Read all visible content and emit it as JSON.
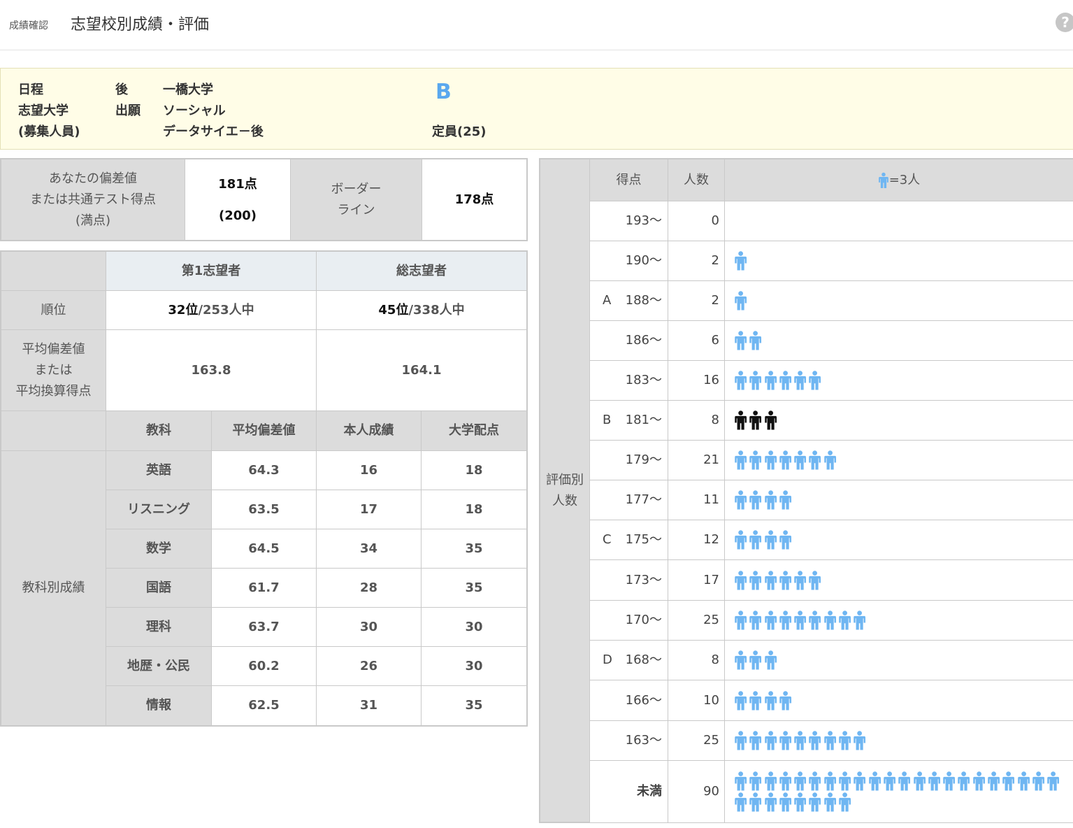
{
  "header": {
    "breadcrumb": "成績確認",
    "title": "志望校別成績・評価",
    "help_icon": "help-circle-icon"
  },
  "info": {
    "label_schedule": "日程",
    "label_university": "志望大学",
    "label_capacity": "(募集人員)",
    "schedule_value": "後",
    "application_label": "出願",
    "university_name": "一橋大学",
    "department": "ソーシャル",
    "course": "データサイエ－後",
    "rank": "B",
    "capacity": "定員(25)",
    "rank_color": "#5aa8ee",
    "background": "#fffde7"
  },
  "score": {
    "label_line1": "あなたの偏差値",
    "label_line2": "または共通テスト得点",
    "label_line3": "(満点)",
    "score_value": "181点",
    "full_marks": "(200)",
    "border_label_line1": "ボーダー",
    "border_label_line2": "ライン",
    "border_value": "178点"
  },
  "ranking": {
    "col1": "第1志望者",
    "col2": "総志望者",
    "rank_label": "順位",
    "first_rank": "32位",
    "first_total": "/253人中",
    "all_rank": "45位",
    "all_total": "/338人中",
    "avg_label_line1": "平均偏差値",
    "avg_label_line2": "または",
    "avg_label_line3": "平均換算得点",
    "first_avg": "163.8",
    "all_avg": "164.1"
  },
  "subjects": {
    "section_label": "教科別成績",
    "headers": [
      "教科",
      "平均偏差値",
      "本人成績",
      "大学配点"
    ],
    "rows": [
      {
        "subject": "英語",
        "avg": "64.3",
        "mine": "16",
        "points": "18"
      },
      {
        "subject": "リスニング",
        "avg": "63.5",
        "mine": "17",
        "points": "18"
      },
      {
        "subject": "数学",
        "avg": "64.5",
        "mine": "34",
        "points": "35"
      },
      {
        "subject": "国語",
        "avg": "61.7",
        "mine": "28",
        "points": "35"
      },
      {
        "subject": "理科",
        "avg": "63.7",
        "mine": "30",
        "points": "30"
      },
      {
        "subject": "地歴・公民",
        "avg": "60.2",
        "mine": "26",
        "points": "30"
      },
      {
        "subject": "情報",
        "avg": "62.5",
        "mine": "31",
        "points": "35"
      }
    ]
  },
  "distribution": {
    "side_label_line1": "評価別",
    "side_label_line2": "人数",
    "col_score": "得点",
    "col_count": "人数",
    "legend": "=3人",
    "person_icon": "person-icon",
    "icon_color": "#6fb6f2",
    "highlight_color": "#111111",
    "rows": [
      {
        "grade": "",
        "score": "193～",
        "count": "0",
        "icons": 0,
        "highlight": false
      },
      {
        "grade": "",
        "score": "190～",
        "count": "2",
        "icons": 1,
        "highlight": false
      },
      {
        "grade": "A",
        "score": "188～",
        "count": "2",
        "icons": 1,
        "highlight": false
      },
      {
        "grade": "",
        "score": "186～",
        "count": "6",
        "icons": 2,
        "highlight": false
      },
      {
        "grade": "",
        "score": "183～",
        "count": "16",
        "icons": 6,
        "highlight": false
      },
      {
        "grade": "B",
        "score": "181～",
        "count": "8",
        "icons": 3,
        "highlight": true
      },
      {
        "grade": "",
        "score": "179～",
        "count": "21",
        "icons": 7,
        "highlight": false
      },
      {
        "grade": "",
        "score": "177～",
        "count": "11",
        "icons": 4,
        "highlight": false
      },
      {
        "grade": "C",
        "score": "175～",
        "count": "12",
        "icons": 4,
        "highlight": false
      },
      {
        "grade": "",
        "score": "173～",
        "count": "17",
        "icons": 6,
        "highlight": false
      },
      {
        "grade": "",
        "score": "170～",
        "count": "25",
        "icons": 9,
        "highlight": false
      },
      {
        "grade": "D",
        "score": "168～",
        "count": "8",
        "icons": 3,
        "highlight": false
      },
      {
        "grade": "",
        "score": "166～",
        "count": "10",
        "icons": 4,
        "highlight": false
      },
      {
        "grade": "",
        "score": "163～",
        "count": "25",
        "icons": 9,
        "highlight": false
      },
      {
        "grade": "",
        "score": "未満",
        "count": "90",
        "icons": 30,
        "highlight": false
      }
    ]
  }
}
